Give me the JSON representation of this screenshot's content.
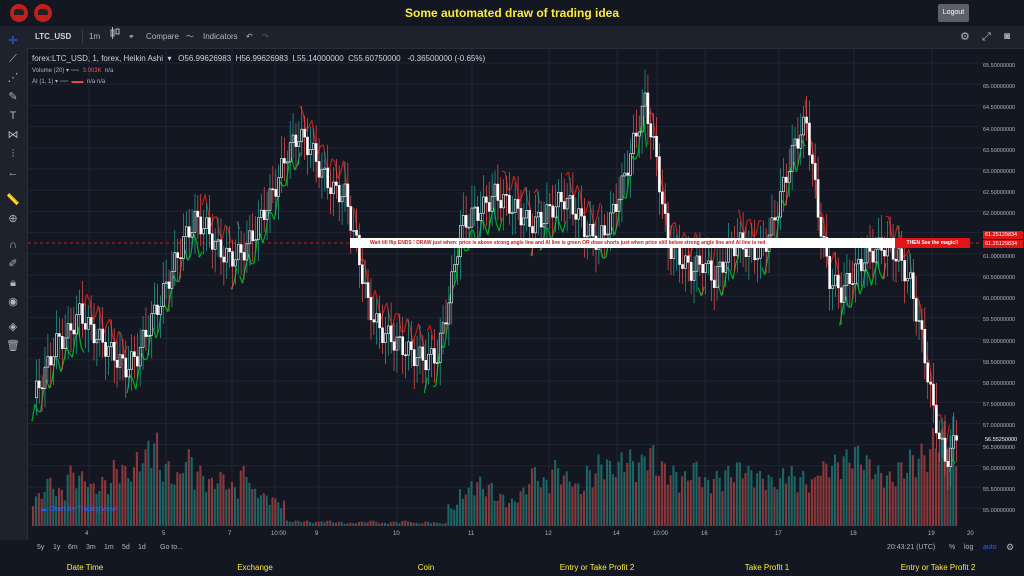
{
  "header": {
    "title": "Some automated draw of trading idea",
    "logout_label": "Logout",
    "logo_left": "logo-1",
    "logo_right": "logo-2"
  },
  "toolbar": {
    "symbol": "LTC_USD",
    "interval": "1m",
    "compare_label": "Compare",
    "indicators_label": "Indicators"
  },
  "legend": {
    "main": "forex:LTC_USD, 1, forex, Heikin Ashi",
    "open": "O56.99626983",
    "high": "H56.99626983",
    "low": "L55.14000000",
    "close": "C55.60750000",
    "change": "-0.36500000 (-0.65%)",
    "volume_title": "Volume (20)",
    "volume_value": "3.003K",
    "volume_na": "n/a",
    "ai_title": "AI (1, 1)",
    "ai_values": "n/a   n/a"
  },
  "annotation": {
    "note": "Wait till flip ENDS  !    DRAW just when:  price is above strong angle line and AI line is green        OR        draw shorts just when price still below strong angle line and AI line is red",
    "magic": "THEN See the magic!!"
  },
  "price_axis": [
    "65.50000000",
    "65.00000000",
    "64.50000000",
    "64.00000000",
    "63.50000000",
    "63.00000000",
    "62.50000000",
    "62.00000000",
    "61.50000000",
    "61.00000000",
    "60.50000000",
    "60.00000000",
    "59.50000000",
    "59.00000000",
    "58.50000000",
    "58.00000000",
    "57.50000000",
    "57.00000000",
    "56.50000000",
    "56.00000000",
    "55.50000000",
    "55.00000000"
  ],
  "price_tags": {
    "tag1": "61.25129834",
    "tag2": "61.25129834",
    "current": "56.55250000"
  },
  "time_axis": [
    "4",
    "5",
    "7",
    "10:00",
    "9",
    "10",
    "11",
    "12",
    "14",
    "10:00",
    "16",
    "17",
    "18",
    "19",
    "20"
  ],
  "bottom": {
    "ranges": [
      "5y",
      "1y",
      "6m",
      "3m",
      "1m",
      "5d",
      "1d"
    ],
    "goto": "Go to...",
    "time": "20:43:21 (UTC)",
    "percent": "%",
    "log": "log",
    "auto": "auto"
  },
  "watermark": "Chart by TradingView",
  "footer": [
    "Date Time",
    "Exchange",
    "Coin",
    "Entry or Take Profit 2",
    "Take Profit 1",
    "Entry or Take Profit 2"
  ],
  "colors": {
    "up": "#26a69a",
    "down": "#ef5350",
    "accent": "#ffeb3b",
    "ai_green": "#00b020",
    "ai_red": "#c0201c"
  },
  "chart_data": {
    "type": "candlestick",
    "style": "Heikin Ashi",
    "y_range": [
      55.0,
      65.5
    ],
    "close_series": [
      57.6,
      58.2,
      58.9,
      59.1,
      59.6,
      59.2,
      58.9,
      58.6,
      58.3,
      58.6,
      59.3,
      59.9,
      60.6,
      61.3,
      61.8,
      61.6,
      61.1,
      60.9,
      61.0,
      61.4,
      62.0,
      62.6,
      63.4,
      63.8,
      63.5,
      62.9,
      62.5,
      62.4,
      61.2,
      59.8,
      59.2,
      59.0,
      58.8,
      58.6,
      58.5,
      58.6,
      59.9,
      61.6,
      61.9,
      62.1,
      62.4,
      62.2,
      62.0,
      61.7,
      61.8,
      62.1,
      62.3,
      62.0,
      61.5,
      61.3,
      61.8,
      62.6,
      63.6,
      64.6,
      63.2,
      61.2,
      60.9,
      60.6,
      60.8,
      60.4,
      60.9,
      61.3,
      61.1,
      61.0,
      61.6,
      62.6,
      63.6,
      64.1,
      62.0,
      60.4,
      60.1,
      60.5,
      60.9,
      61.1,
      61.2,
      60.9,
      60.3,
      59.0,
      57.3,
      56.1,
      56.6
    ],
    "volume_relative": [
      0.3,
      0.45,
      0.35,
      0.55,
      0.5,
      0.4,
      0.45,
      0.6,
      0.55,
      0.7,
      0.85,
      0.6,
      0.5,
      0.7,
      0.55,
      0.45,
      0.5,
      0.4,
      0.55,
      0.35,
      0.3,
      0.25,
      0.05,
      0.05,
      0.04,
      0.05,
      0.04,
      0.03,
      0.04,
      0.05,
      0.03,
      0.04,
      0.05,
      0.03,
      0.04,
      0.03,
      0.2,
      0.35,
      0.45,
      0.4,
      0.3,
      0.25,
      0.35,
      0.55,
      0.45,
      0.6,
      0.5,
      0.4,
      0.55,
      0.65,
      0.6,
      0.7,
      0.65,
      0.75,
      0.6,
      0.55,
      0.5,
      0.6,
      0.45,
      0.5,
      0.55,
      0.6,
      0.55,
      0.5,
      0.45,
      0.55,
      0.5,
      0.45,
      0.6,
      0.65,
      0.7,
      0.75,
      0.65,
      0.55,
      0.5,
      0.6,
      0.7,
      0.75,
      0.9,
      1.0,
      0.6
    ]
  }
}
